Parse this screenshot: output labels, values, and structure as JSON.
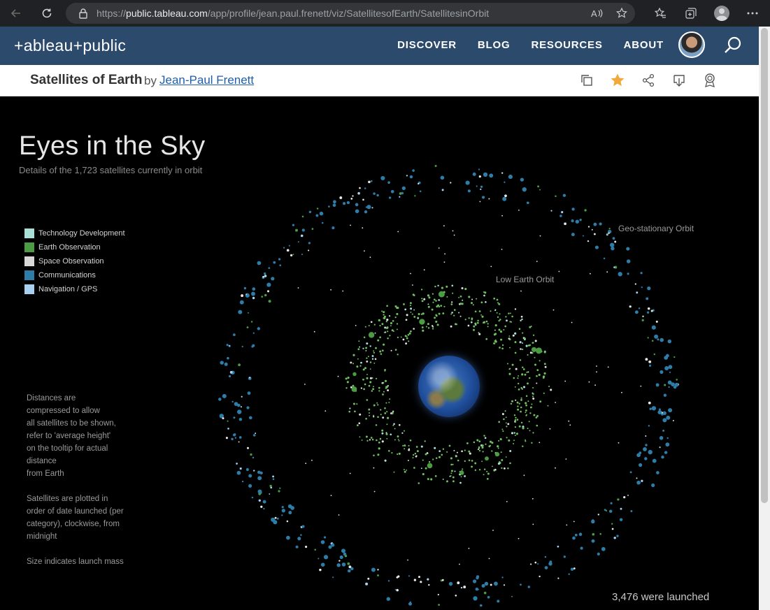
{
  "browser": {
    "url_prefix": "https://",
    "url_host": "public.tableau.com",
    "url_path": "/app/profile/jean.paul.frenett/viz/SatellitesofEarth/SatellitesinOrbit"
  },
  "header": {
    "logo": "+ableau+public",
    "nav": [
      "DISCOVER",
      "BLOG",
      "RESOURCES",
      "ABOUT"
    ]
  },
  "viz_bar": {
    "title": "Satellites of Earth",
    "by": "by",
    "author": "Jean-Paul Frenett"
  },
  "viz": {
    "heading": "Eyes in the Sky",
    "subheading": "Details of the 1,723 satellites currently in orbit",
    "legend": [
      {
        "label": "Technology Development",
        "color": "#a8e0d8"
      },
      {
        "label": "Earth Observation",
        "color": "#4c9c44"
      },
      {
        "label": "Space Observation",
        "color": "#d8d8d8"
      },
      {
        "label": "Communications",
        "color": "#2e7da8"
      },
      {
        "label": "Navigation / GPS",
        "color": "#a8d0f0"
      }
    ],
    "note1": "Distances are\ncompressed to allow\nall satellites to be shown,\nrefer to 'average height'\non the tooltip for actual\ndistance\nfrom Earth",
    "note2": "Satellites are plotted in\norder of date launched (per\ncategory), clockwise, from\nmidnight",
    "note3": "Size indicates launch mass",
    "orbit_geo": "Geo-stationary Orbit",
    "orbit_leo": "Low Earth Orbit",
    "launched": "3,476 were launched"
  }
}
